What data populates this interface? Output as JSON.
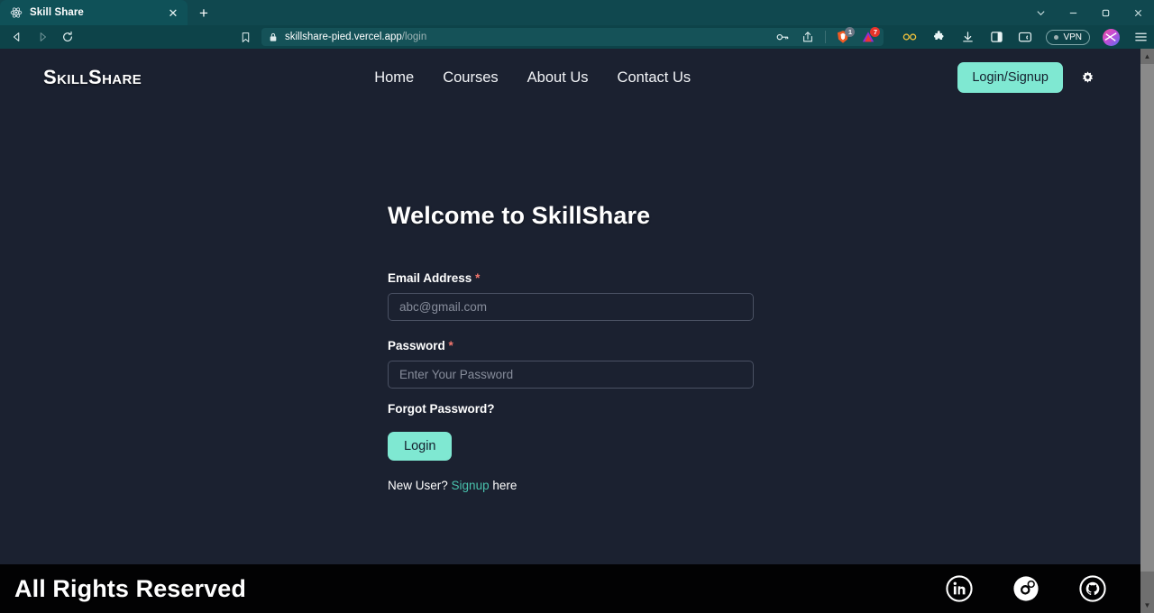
{
  "browser": {
    "tab": {
      "title": "Skill Share",
      "favicon_icon": "react-atom-icon",
      "close_icon": "close-icon"
    },
    "newtab_icon": "plus-icon",
    "window_controls": [
      {
        "name": "tab-search",
        "icon": "chevron-down-icon",
        "glyph": "⌄"
      },
      {
        "name": "minimize",
        "icon": "minimize-icon",
        "glyph": "—"
      },
      {
        "name": "maximize",
        "icon": "maximize-icon",
        "glyph": "❐"
      },
      {
        "name": "close-window",
        "icon": "close-icon",
        "glyph": "✕"
      }
    ],
    "nav": {
      "back_icon": "back-arrow-icon",
      "forward_icon": "forward-arrow-icon",
      "reload_icon": "reload-icon",
      "bookmark_icon": "bookmark-icon"
    },
    "address": {
      "lock_icon": "lock-icon",
      "domain": "skillshare-pied.vercel.app",
      "path": "/login",
      "password_icon": "key-icon",
      "share_icon": "share-icon"
    },
    "shields": {
      "brave_icon": "brave-shield-icon",
      "brave_badge": "1",
      "alert_icon": "triangle-alert-icon",
      "alert_badge": "7"
    },
    "extensions": [
      {
        "name": "extension-infinity-icon",
        "icon": "infinity-icon"
      },
      {
        "name": "extensions-puzzle-icon",
        "icon": "puzzle-icon"
      },
      {
        "name": "downloads-icon",
        "icon": "download-icon"
      },
      {
        "name": "sidebar-toggle-icon",
        "icon": "sidebar-icon"
      },
      {
        "name": "wallet-icon",
        "icon": "wallet-icon"
      }
    ],
    "vpn": {
      "label": "VPN"
    },
    "profile_icon": "profile-avatar-icon",
    "menu_icon": "hamburger-menu-icon"
  },
  "site": {
    "logo": "SkillShare",
    "nav_links": [
      {
        "label": "Home"
      },
      {
        "label": "Courses"
      },
      {
        "label": "About Us"
      },
      {
        "label": "Contact Us"
      }
    ],
    "login_signup_label": "Login/Signup",
    "settings_icon": "gear-icon"
  },
  "main": {
    "heading": "Welcome to SkillShare",
    "email": {
      "label": "Email Address",
      "required_mark": "*",
      "placeholder": "abc@gmail.com",
      "value": ""
    },
    "password": {
      "label": "Password",
      "required_mark": "*",
      "placeholder": "Enter Your Password",
      "value": ""
    },
    "forgot_password": "Forgot Password?",
    "login_button": "Login",
    "new_user_prefix": "New User?",
    "signup_link": "Signup",
    "new_user_suffix": "here"
  },
  "footer": {
    "text": "All Rights Reserved",
    "socials": [
      {
        "name": "linkedin-icon"
      },
      {
        "name": "instagram-icon"
      },
      {
        "name": "github-icon"
      }
    ]
  },
  "colors": {
    "accent_mint": "#7fe8d2",
    "link_teal": "#49c2ad",
    "required_red": "#f4776e",
    "page_bg": "#1b2130",
    "footer_bg": "#020203",
    "chrome_bg": "#0d4349"
  }
}
